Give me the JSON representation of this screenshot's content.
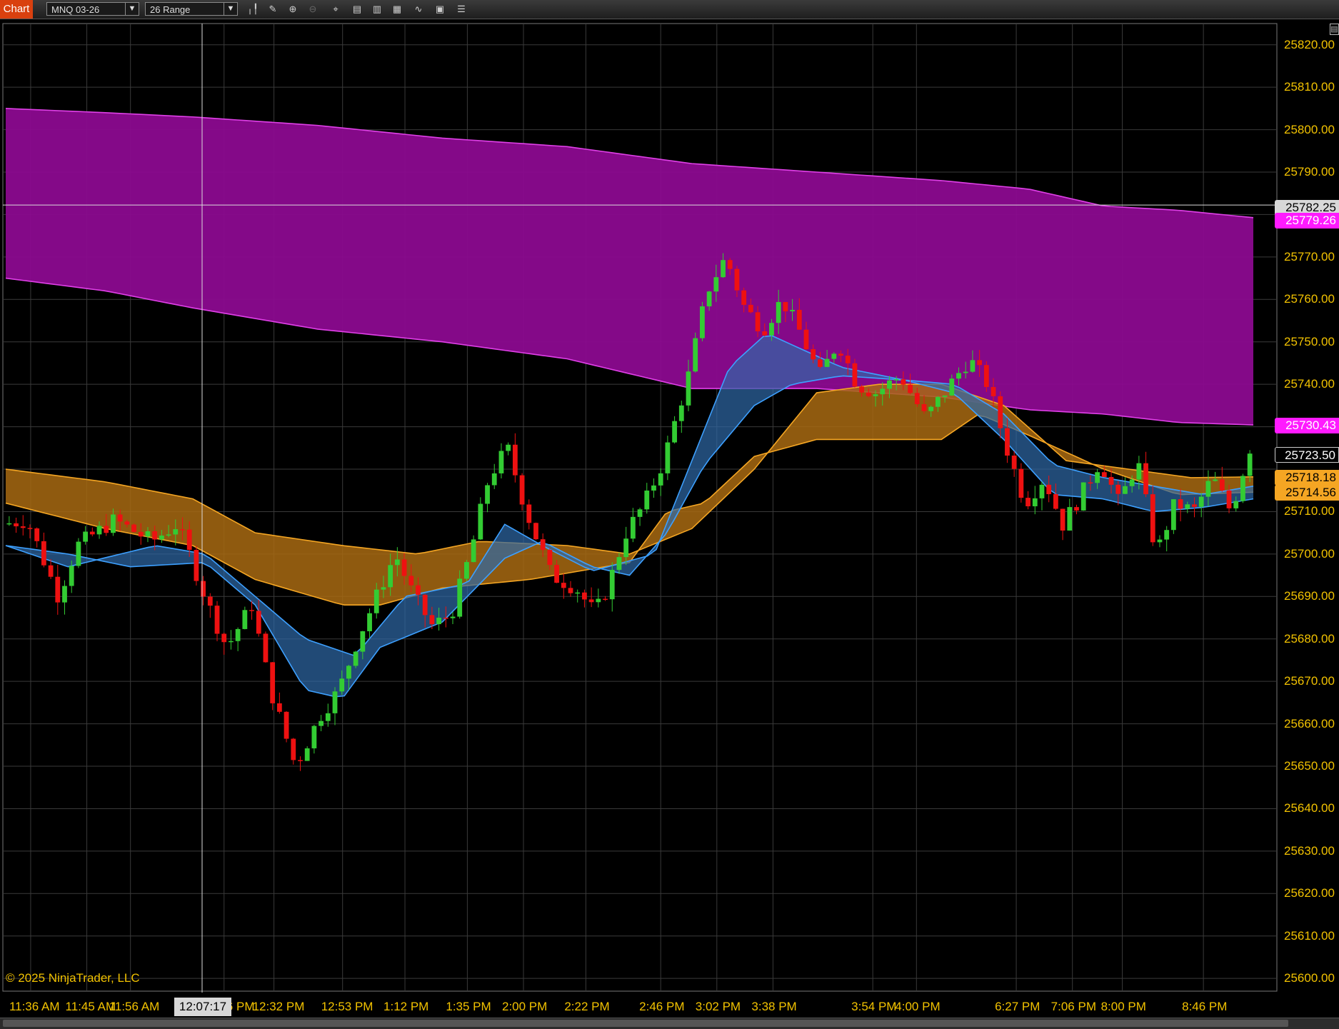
{
  "toolbar": {
    "tab_label": "Chart",
    "instrument": "MNQ 03-26",
    "bar_type": "26 Range",
    "tools": [
      "bars-icon",
      "draw-icon",
      "zoom-in-icon",
      "zoom-out-icon",
      "crosshair-icon",
      "data-box-icon",
      "properties-icon",
      "strategies-icon",
      "indicators-icon",
      "templates-icon",
      "list-icon"
    ]
  },
  "crosshair": {
    "time": "12:07:17",
    "price": "25782.25"
  },
  "price_axis": {
    "ticks": [
      "25820.00",
      "25810.00",
      "25800.00",
      "25790.00",
      "25770.00",
      "25760.00",
      "25750.00",
      "25740.00",
      "25710.00",
      "25700.00",
      "25690.00",
      "25680.00",
      "25670.00",
      "25660.00",
      "25650.00",
      "25640.00",
      "25630.00",
      "25620.00",
      "25610.00",
      "25600.00"
    ],
    "range": [
      25597,
      25825
    ]
  },
  "price_tags": {
    "crosshair": "25782.25",
    "magenta": "25779.26",
    "magenta_low": "25730.43",
    "last": "25723.50",
    "orange_high": "25718.18",
    "orange_low": "25714.56"
  },
  "time_axis": [
    "11:36 AM",
    "11:45 AM",
    "11:56 AM",
    "12:26 PM",
    "12:32 PM",
    "12:53 PM",
    "1:12 PM",
    "1:35 PM",
    "2:00 PM",
    "2:22 PM",
    "2:46 PM",
    "3:02 PM",
    "3:38 PM",
    "3:54 PM",
    "4:00 PM",
    "6:27 PM",
    "7:06 PM",
    "8:00 PM",
    "8:46 PM"
  ],
  "copyright": "© 2025 NinjaTrader, LLC",
  "colors": {
    "background": "#000000",
    "grid": "#3a3a3a",
    "axis_text": "#f2c200",
    "up_candle": "#33cc33",
    "down_candle": "#ee1111",
    "magenta_cloud": "#8b0a8f",
    "magenta_edge": "#e040e8",
    "orange_cloud": "#a86a12",
    "orange_edge": "#f5a623",
    "blue_cloud": "#2f6aa8",
    "blue_edge": "#3da0ff"
  },
  "chart_data": {
    "type": "candlestick",
    "instrument": "MNQ 03-26",
    "ylim": [
      25597,
      25825
    ],
    "candle_count": 180,
    "price_path": [
      [
        0,
        25707
      ],
      [
        0.02,
        25708
      ],
      [
        0.045,
        25690
      ],
      [
        0.06,
        25702
      ],
      [
        0.09,
        25708
      ],
      [
        0.12,
        25703
      ],
      [
        0.14,
        25707
      ],
      [
        0.15,
        25700
      ],
      [
        0.165,
        25688
      ],
      [
        0.18,
        25678
      ],
      [
        0.2,
        25688
      ],
      [
        0.215,
        25668
      ],
      [
        0.235,
        25650
      ],
      [
        0.255,
        25662
      ],
      [
        0.27,
        25668
      ],
      [
        0.285,
        25680
      ],
      [
        0.3,
        25690
      ],
      [
        0.315,
        25700
      ],
      [
        0.33,
        25690
      ],
      [
        0.345,
        25683
      ],
      [
        0.36,
        25686
      ],
      [
        0.375,
        25700
      ],
      [
        0.39,
        25718
      ],
      [
        0.405,
        25725
      ],
      [
        0.42,
        25710
      ],
      [
        0.44,
        25695
      ],
      [
        0.46,
        25692
      ],
      [
        0.475,
        25686
      ],
      [
        0.485,
        25692
      ],
      [
        0.5,
        25705
      ],
      [
        0.515,
        25712
      ],
      [
        0.53,
        25722
      ],
      [
        0.55,
        25742
      ],
      [
        0.565,
        25762
      ],
      [
        0.58,
        25770
      ],
      [
        0.595,
        25758
      ],
      [
        0.61,
        25753
      ],
      [
        0.625,
        25760
      ],
      [
        0.64,
        25752
      ],
      [
        0.655,
        25742
      ],
      [
        0.67,
        25750
      ],
      [
        0.685,
        25740
      ],
      [
        0.7,
        25738
      ],
      [
        0.72,
        25742
      ],
      [
        0.74,
        25732
      ],
      [
        0.76,
        25740
      ],
      [
        0.775,
        25746
      ],
      [
        0.79,
        25740
      ],
      [
        0.805,
        25725
      ],
      [
        0.82,
        25712
      ],
      [
        0.835,
        25718
      ],
      [
        0.85,
        25707
      ],
      [
        0.865,
        25714
      ],
      [
        0.88,
        25722
      ],
      [
        0.895,
        25712
      ],
      [
        0.91,
        25722
      ],
      [
        0.925,
        25700
      ],
      [
        0.94,
        25712
      ],
      [
        0.955,
        25710
      ],
      [
        0.97,
        25718
      ],
      [
        0.985,
        25710
      ],
      [
        1,
        25725
      ]
    ],
    "magenta_cloud": {
      "upper": [
        [
          0,
          25805
        ],
        [
          0.08,
          25804
        ],
        [
          0.15,
          25803
        ],
        [
          0.25,
          25801
        ],
        [
          0.35,
          25798
        ],
        [
          0.45,
          25796
        ],
        [
          0.55,
          25792
        ],
        [
          0.65,
          25790
        ],
        [
          0.75,
          25788
        ],
        [
          0.82,
          25786
        ],
        [
          0.88,
          25782
        ],
        [
          0.94,
          25781
        ],
        [
          1,
          25779.26
        ]
      ],
      "lower": [
        [
          0,
          25765
        ],
        [
          0.08,
          25762
        ],
        [
          0.15,
          25758
        ],
        [
          0.25,
          25753
        ],
        [
          0.35,
          25750
        ],
        [
          0.45,
          25746
        ],
        [
          0.55,
          25739
        ],
        [
          0.65,
          25739
        ],
        [
          0.75,
          25737
        ],
        [
          0.82,
          25734
        ],
        [
          0.88,
          25733
        ],
        [
          0.94,
          25731
        ],
        [
          1,
          25730.43
        ]
      ]
    },
    "orange_cloud": {
      "upper": [
        [
          0,
          25720
        ],
        [
          0.08,
          25717
        ],
        [
          0.15,
          25713
        ],
        [
          0.2,
          25705
        ],
        [
          0.27,
          25702
        ],
        [
          0.33,
          25700
        ],
        [
          0.38,
          25703
        ],
        [
          0.45,
          25702
        ],
        [
          0.5,
          25700
        ],
        [
          0.55,
          25706
        ],
        [
          0.6,
          25720
        ],
        [
          0.65,
          25738
        ],
        [
          0.7,
          25740
        ],
        [
          0.75,
          25740
        ],
        [
          0.8,
          25735
        ],
        [
          0.85,
          25722
        ],
        [
          0.9,
          25720
        ],
        [
          0.95,
          25718
        ],
        [
          1,
          25718.18
        ]
      ],
      "lower": [
        [
          0,
          25712
        ],
        [
          0.08,
          25706
        ],
        [
          0.15,
          25702
        ],
        [
          0.2,
          25694
        ],
        [
          0.27,
          25688
        ],
        [
          0.3,
          25688
        ],
        [
          0.35,
          25692
        ],
        [
          0.42,
          25694
        ],
        [
          0.5,
          25698
        ],
        [
          0.53,
          25710
        ],
        [
          0.56,
          25712
        ],
        [
          0.6,
          25723
        ],
        [
          0.65,
          25727
        ],
        [
          0.7,
          25727
        ],
        [
          0.75,
          25727
        ],
        [
          0.78,
          25733
        ],
        [
          0.82,
          25728
        ],
        [
          0.88,
          25720
        ],
        [
          0.94,
          25714
        ],
        [
          1,
          25714.56
        ]
      ]
    },
    "blue_cloud": {
      "upper": [
        [
          0,
          25702
        ],
        [
          0.05,
          25697
        ],
        [
          0.12,
          25702
        ],
        [
          0.16,
          25700
        ],
        [
          0.2,
          25690
        ],
        [
          0.24,
          25680
        ],
        [
          0.28,
          25676
        ],
        [
          0.32,
          25690
        ],
        [
          0.37,
          25693
        ],
        [
          0.4,
          25707
        ],
        [
          0.43,
          25702
        ],
        [
          0.47,
          25696
        ],
        [
          0.52,
          25700
        ],
        [
          0.55,
          25722
        ],
        [
          0.58,
          25744
        ],
        [
          0.61,
          25752
        ],
        [
          0.64,
          25748
        ],
        [
          0.67,
          25744
        ],
        [
          0.72,
          25741
        ],
        [
          0.76,
          25740
        ],
        [
          0.8,
          25733
        ],
        [
          0.84,
          25721
        ],
        [
          0.88,
          25718
        ],
        [
          0.92,
          25716
        ],
        [
          0.96,
          25714
        ],
        [
          1,
          25716
        ]
      ],
      "lower": [
        [
          0,
          25702
        ],
        [
          0.05,
          25700
        ],
        [
          0.1,
          25697
        ],
        [
          0.16,
          25698
        ],
        [
          0.2,
          25688
        ],
        [
          0.24,
          25668
        ],
        [
          0.27,
          25666
        ],
        [
          0.3,
          25678
        ],
        [
          0.35,
          25684
        ],
        [
          0.4,
          25699
        ],
        [
          0.43,
          25703
        ],
        [
          0.47,
          25697
        ],
        [
          0.5,
          25695
        ],
        [
          0.53,
          25705
        ],
        [
          0.56,
          25721
        ],
        [
          0.6,
          25735
        ],
        [
          0.63,
          25740
        ],
        [
          0.67,
          25742
        ],
        [
          0.72,
          25741
        ],
        [
          0.76,
          25738
        ],
        [
          0.8,
          25727
        ],
        [
          0.84,
          25714
        ],
        [
          0.88,
          25713
        ],
        [
          0.92,
          25710
        ],
        [
          0.96,
          25711
        ],
        [
          1,
          25713
        ]
      ]
    }
  }
}
